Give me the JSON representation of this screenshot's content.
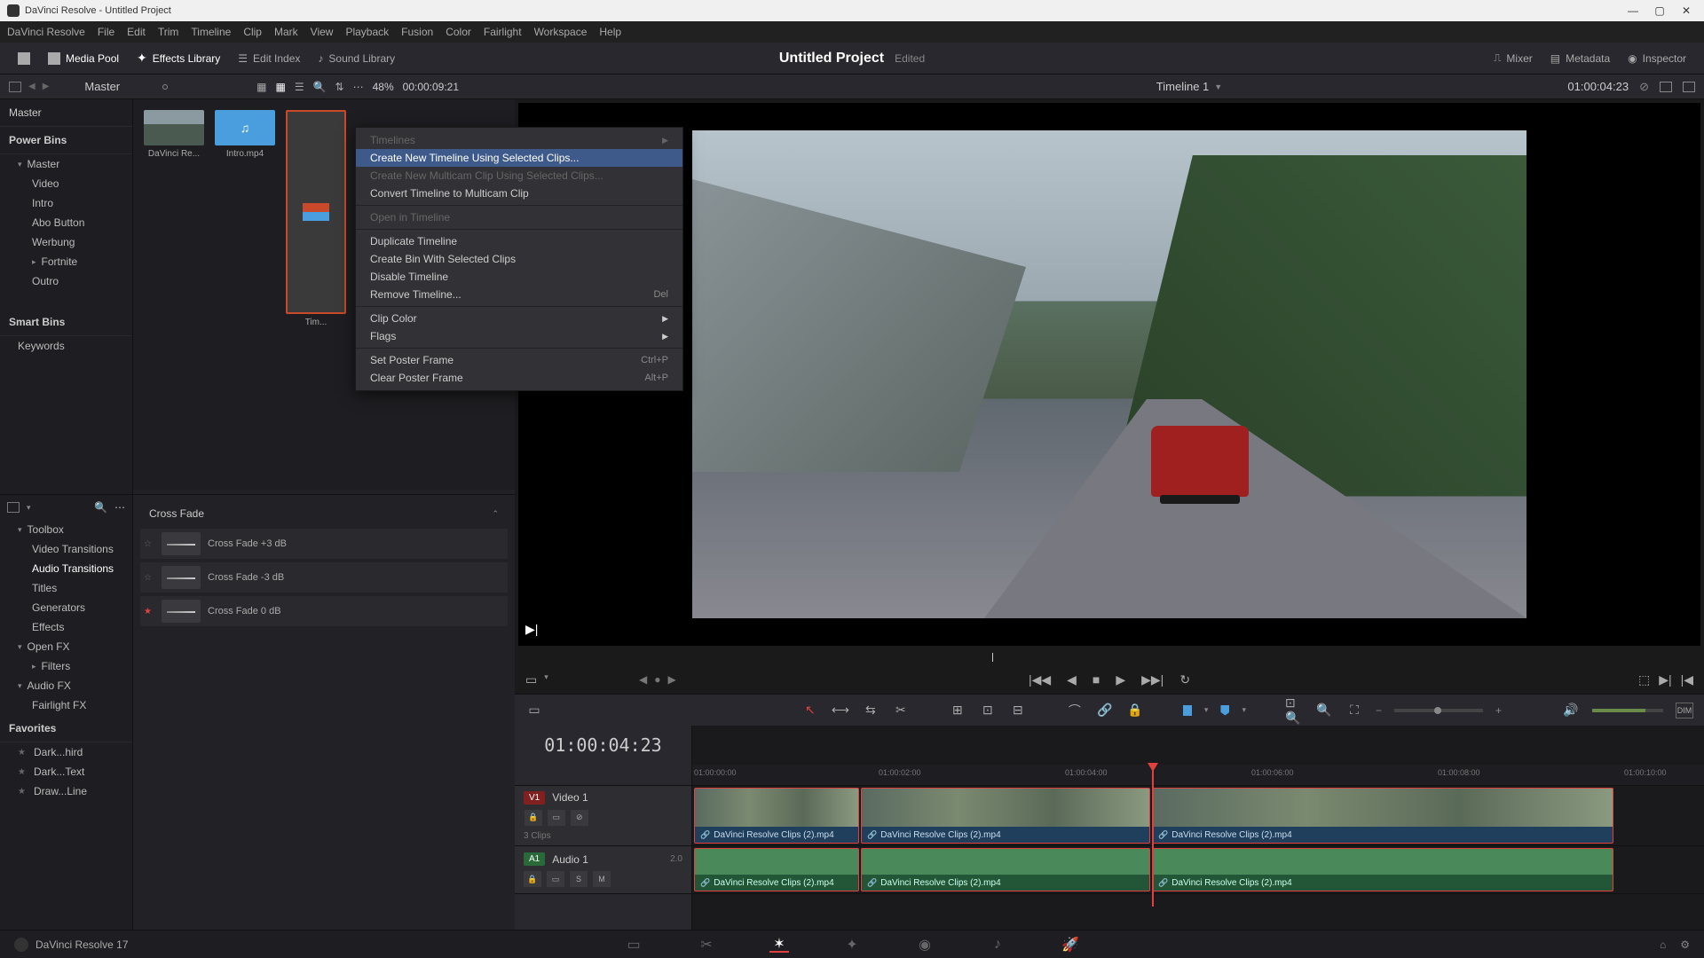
{
  "window": {
    "title": "DaVinci Resolve - Untitled Project"
  },
  "menubar": [
    "DaVinci Resolve",
    "File",
    "Edit",
    "Trim",
    "Timeline",
    "Clip",
    "Mark",
    "View",
    "Playback",
    "Fusion",
    "Color",
    "Fairlight",
    "Workspace",
    "Help"
  ],
  "toolbar": {
    "media_pool": "Media Pool",
    "effects_library": "Effects Library",
    "edit_index": "Edit Index",
    "sound_library": "Sound Library",
    "mixer": "Mixer",
    "metadata": "Metadata",
    "inspector": "Inspector"
  },
  "project": {
    "title": "Untitled Project",
    "status": "Edited"
  },
  "secbar": {
    "breadcrumb": "Master",
    "zoom": "48%",
    "timecode_left": "00:00:09:21",
    "timeline_name": "Timeline 1",
    "timecode_right": "01:00:04:23"
  },
  "sidebar": {
    "master": "Master",
    "power_bins": "Power Bins",
    "items": [
      {
        "label": "Master",
        "expandable": true
      },
      {
        "label": "Video",
        "sub": true
      },
      {
        "label": "Intro",
        "sub": true
      },
      {
        "label": "Abo Button",
        "sub": true
      },
      {
        "label": "Werbung",
        "sub": true
      },
      {
        "label": "Fortnite",
        "sub": true,
        "expandable": true
      },
      {
        "label": "Outro",
        "sub": true
      }
    ],
    "smart_bins": "Smart Bins",
    "keywords": "Keywords"
  },
  "thumbs": [
    {
      "label": "DaVinci Re...",
      "kind": "landscape"
    },
    {
      "label": "Intro.mp4",
      "kind": "blue"
    },
    {
      "label": "Tim...",
      "kind": "timeline"
    }
  ],
  "context_menu": [
    {
      "label": "Timelines",
      "arrow": true,
      "disabled": true
    },
    {
      "label": "Create New Timeline Using Selected Clips...",
      "hover": true
    },
    {
      "label": "Create New Multicam Clip Using Selected Clips...",
      "disabled": true
    },
    {
      "label": "Convert Timeline to Multicam Clip"
    },
    {
      "sep": true
    },
    {
      "label": "Open in Timeline",
      "disabled": true
    },
    {
      "sep": true
    },
    {
      "label": "Duplicate Timeline"
    },
    {
      "label": "Create Bin With Selected Clips"
    },
    {
      "label": "Disable Timeline"
    },
    {
      "label": "Remove Timeline...",
      "shortcut": "Del"
    },
    {
      "sep": true
    },
    {
      "label": "Clip Color",
      "arrow": true
    },
    {
      "label": "Flags",
      "arrow": true
    },
    {
      "sep": true
    },
    {
      "label": "Set Poster Frame",
      "shortcut": "Ctrl+P"
    },
    {
      "label": "Clear Poster Frame",
      "shortcut": "Alt+P"
    }
  ],
  "effects_tree": {
    "toolbox": "Toolbox",
    "items": [
      "Video Transitions",
      "Audio Transitions",
      "Titles",
      "Generators",
      "Effects"
    ],
    "openfx": "Open FX",
    "filters": "Filters",
    "audiofx": "Audio FX",
    "fairlight": "Fairlight FX",
    "favorites": "Favorites",
    "fav_items": [
      "Dark...hird",
      "Dark...Text",
      "Draw...Line"
    ]
  },
  "effects": {
    "header": "Cross Fade",
    "list": [
      "Cross Fade +3 dB",
      "Cross Fade -3 dB",
      "Cross Fade 0 dB"
    ]
  },
  "timeline": {
    "timecode": "01:00:04:23",
    "video_track": {
      "badge": "V1",
      "name": "Video 1",
      "clips_meta": "3 Clips"
    },
    "audio_track": {
      "badge": "A1",
      "name": "Audio 1",
      "meter": "2.0"
    },
    "clip_name": "DaVinci Resolve Clips (2).mp4",
    "ruler_labels": [
      "01:00:00:00",
      "01:00:02:00",
      "01:00:04:00",
      "01:00:06:00",
      "01:00:08:00",
      "01:00:10:00"
    ]
  },
  "bottombar": {
    "app": "DaVinci Resolve 17"
  },
  "track_buttons": {
    "lock": "🔒",
    "frame": "▭",
    "solo": "S",
    "mute": "M"
  }
}
